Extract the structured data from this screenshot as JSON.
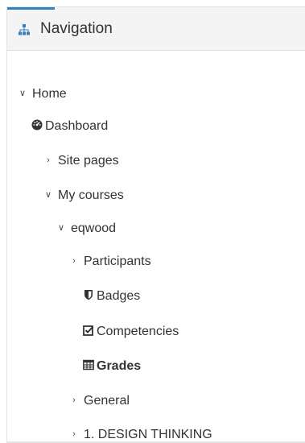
{
  "block": {
    "title": "Navigation",
    "accent_color": "#2e81c9",
    "icon": "sitemap-icon"
  },
  "tree": {
    "home": {
      "label": "Home",
      "state": "expanded"
    },
    "dashboard": {
      "label": "Dashboard",
      "icon": "tachometer-icon"
    },
    "site_pages": {
      "label": "Site pages",
      "state": "collapsed"
    },
    "my_courses": {
      "label": "My courses",
      "state": "expanded"
    },
    "course": {
      "label": "eqwood",
      "state": "expanded"
    },
    "participants": {
      "label": "Participants",
      "state": "collapsed"
    },
    "badges": {
      "label": "Badges",
      "icon": "shield-icon"
    },
    "competencies": {
      "label": "Competencies",
      "icon": "check-square-icon"
    },
    "grades": {
      "label": "Grades",
      "icon": "table-icon",
      "active": true
    },
    "general": {
      "label": "General",
      "state": "collapsed"
    },
    "design_thinking": {
      "label": "1. DESIGN THINKING",
      "state": "collapsed"
    }
  }
}
